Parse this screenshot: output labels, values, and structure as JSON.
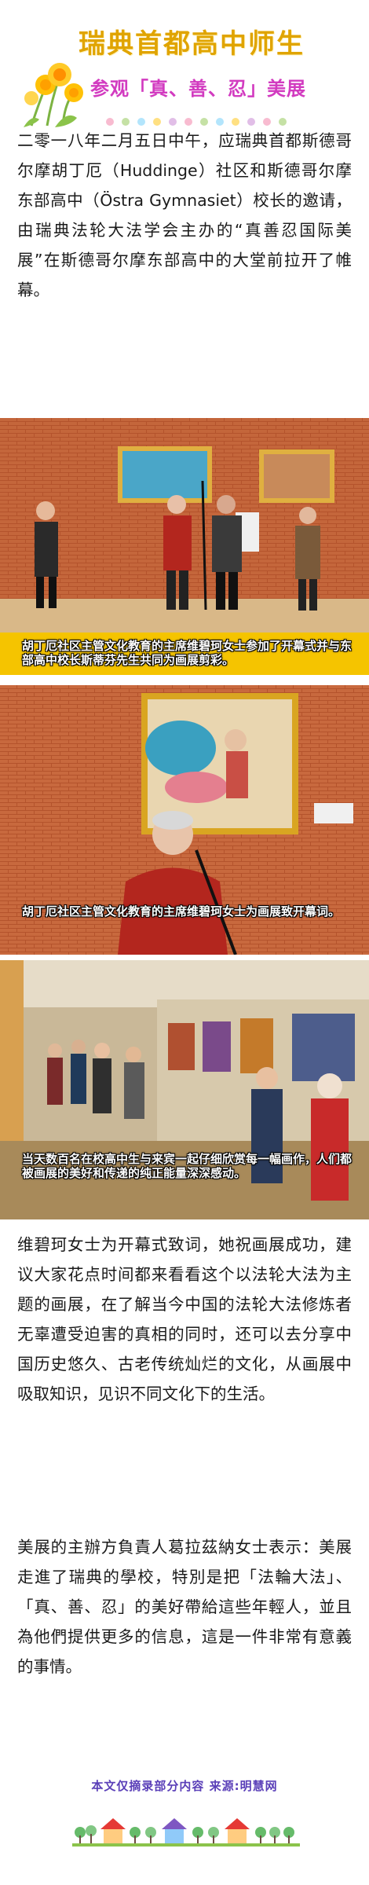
{
  "header": {
    "title": "瑞典首都高中师生",
    "subtitle": "参观「真、善、忍」美展"
  },
  "article": {
    "paragraph_1": "二零一八年二月五日中午，应瑞典首都斯德哥尔摩胡丁厄（Huddinge）社区和斯德哥尔摩东部高中（Östra Gymnasiet）校长的邀请，由瑞典法轮大法学会主办的“真善忍国际美展”在斯德哥尔摩东部高中的大堂前拉开了帷幕。",
    "paragraph_2": "维碧珂女士为开幕式致词，她祝画展成功，建议大家花点时间都来看看这个以法轮大法为主题的画展，在了解当今中国的法轮大法修炼者无辜遭受迫害的真相的同时，还可以去分享中国历史悠久、古老传统灿烂的文化，从画展中吸取知识，见识不同文化下的生活。",
    "paragraph_3": "美展的主辦方負責人葛拉茲納女士表示：美展走進了瑞典的學校，特別是把「法輪大法」、「真、善、忍」的美好帶給這些年輕人，並且為他們提供更多的信息，這是一件非常有意義的事情。"
  },
  "photos": {
    "caption_1": "胡丁厄社区主管文化教育的主席维碧珂女士参加了开幕式并与东部高中校长斯蒂芬先生共同为画展剪彩。",
    "caption_2": "胡丁厄社区主管文化教育的主席维碧珂女士为画展致开幕词。",
    "caption_3": "当天数百名在校高中生与来宾一起仔细欣赏每一幅画作，人们都被画展的美好和传递的纯正能量深深感动。"
  },
  "footer": {
    "note": "本文仅摘录部分内容  来源:明慧网"
  },
  "colors": {
    "title": "#e0a400",
    "subtitle": "#d23bc0",
    "caption_bar": "#f5c400",
    "footer_note": "#5a3fb8",
    "brick": "#b4532c"
  }
}
